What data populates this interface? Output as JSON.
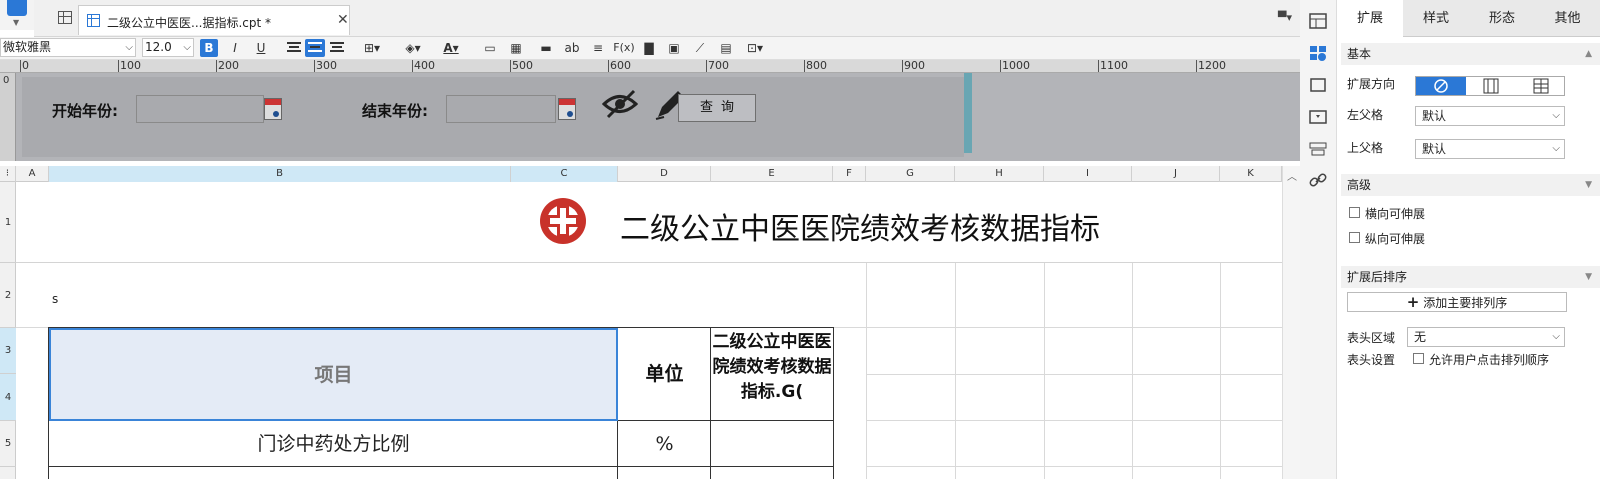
{
  "tab": {
    "title": "二级公立中医医...据指标.cpt *"
  },
  "toolbar": {
    "font_family": "微软雅黑",
    "font_size": "12.0",
    "bold": "B",
    "italic": "I",
    "underline": "U",
    "text_label": "ab",
    "formula_label": "F(x)"
  },
  "ruler": {
    "ticks": [
      "0",
      "100",
      "200",
      "300",
      "400",
      "500",
      "600",
      "700",
      "800",
      "900",
      "1000",
      "1100",
      "1200"
    ]
  },
  "param_panel": {
    "row_marker": "0",
    "start_year_label": "开始年份:",
    "end_year_label": "结束年份:",
    "query_button": "查询"
  },
  "sheet": {
    "columns": [
      "A",
      "B",
      "C",
      "D",
      "E",
      "F",
      "G",
      "H",
      "I",
      "J",
      "K"
    ],
    "rows": [
      "1",
      "2",
      "3",
      "4",
      "5"
    ],
    "title": "二级公立中医医院绩效考核数据指标",
    "s_marker": "s",
    "header_item": "项目",
    "header_unit": "单位",
    "header_metric": "二级公立中医医院绩效考核数据指标.G(",
    "row5_item": "门诊中药处方比例",
    "row5_unit": "%"
  },
  "right_panel": {
    "tabs": [
      "扩展",
      "样式",
      "形态",
      "其他"
    ],
    "section_basic": "基本",
    "expand_direction_label": "扩展方向",
    "left_parent_label": "左父格",
    "left_parent_value": "默认",
    "top_parent_label": "上父格",
    "top_parent_value": "默认",
    "section_advanced": "高级",
    "horizontal_stretch": "横向可伸展",
    "vertical_stretch": "纵向可伸展",
    "section_sort": "扩展后排序",
    "add_sort_button": "添加主要排列序",
    "header_area_label": "表头区域",
    "header_area_value": "无",
    "header_settings_label": "表头设置",
    "allow_user_sort": "允许用户点击排列顺序"
  },
  "colors": {
    "accent": "#2b78d6",
    "selection_fill": "#e4ebf6",
    "param_bg": "#b3b4b8",
    "logo_red": "#c8322a"
  }
}
